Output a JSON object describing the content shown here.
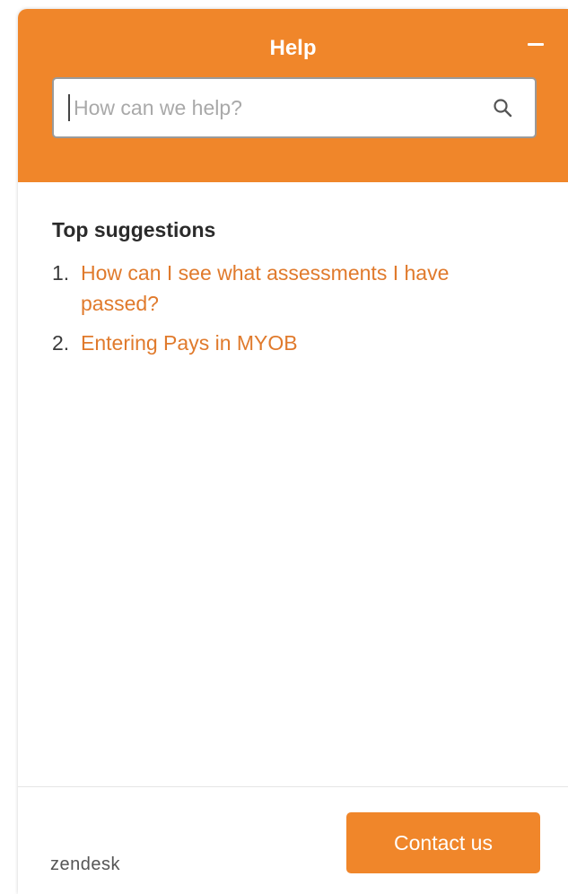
{
  "header": {
    "title": "Help",
    "minimize_icon": "minimize-icon"
  },
  "search": {
    "value": "",
    "placeholder": "How can we help?",
    "icon": "search-icon"
  },
  "suggestions": {
    "title": "Top suggestions",
    "items": [
      {
        "number": "1.",
        "label": "How can I see what assessments I have passed?"
      },
      {
        "number": "2.",
        "label": "Entering Pays in MYOB"
      }
    ]
  },
  "footer": {
    "brand": "zendesk",
    "contact_label": "Contact us"
  },
  "colors": {
    "accent": "#f0862a",
    "link": "#e07a2c"
  }
}
